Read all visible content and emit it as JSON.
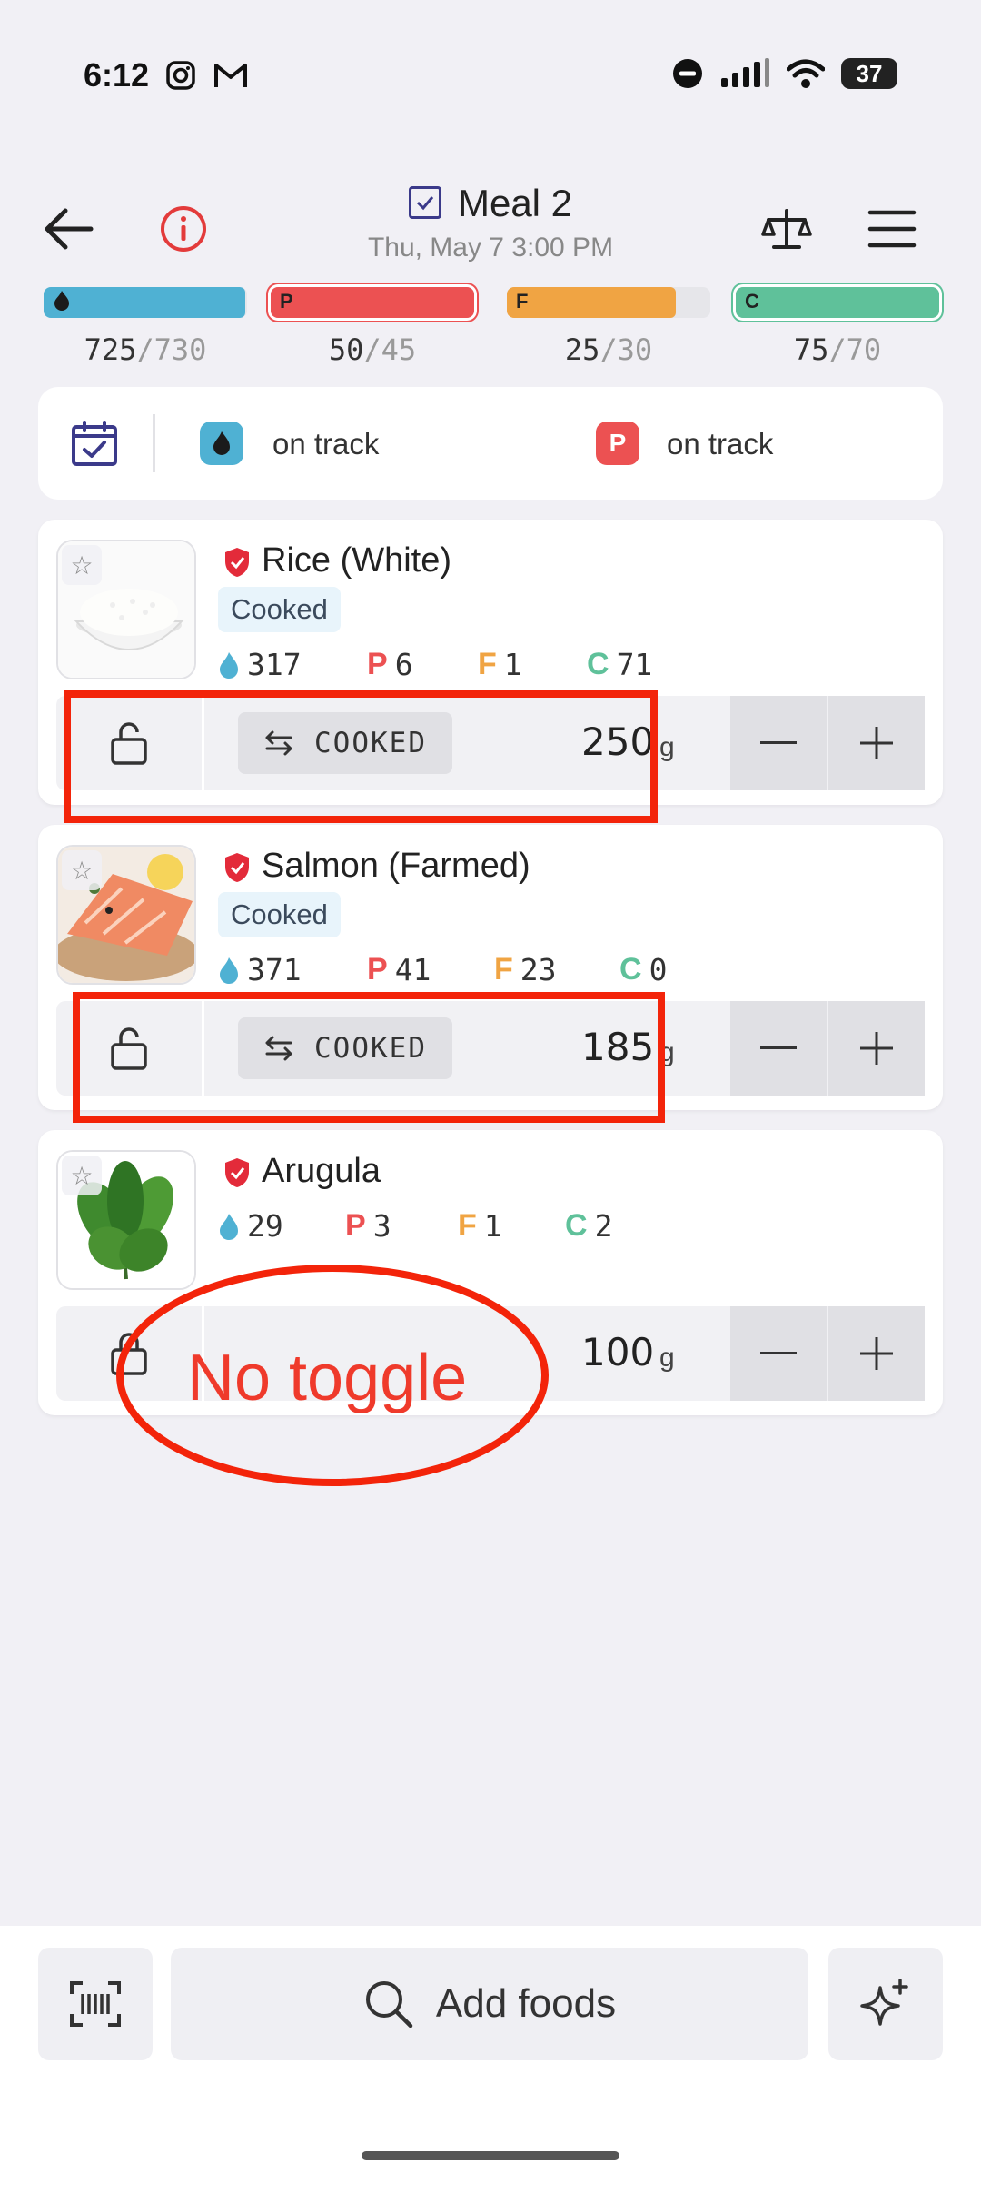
{
  "status_bar": {
    "time": "6:12",
    "battery": "37"
  },
  "header": {
    "title": "Meal 2",
    "subtitle": "Thu, May 7 3:00 PM"
  },
  "macros": [
    {
      "letter": "",
      "current": "725",
      "target": "/730",
      "color": "#4fb1d3",
      "fill": 0.99,
      "outline": false
    },
    {
      "letter": "P",
      "current": "50",
      "target": "/45",
      "color": "#ec5152",
      "fill": 1.0,
      "outline": true
    },
    {
      "letter": "F",
      "current": "25",
      "target": "/30",
      "color": "#f0a443",
      "fill": 0.83,
      "outline": false
    },
    {
      "letter": "C",
      "current": "75",
      "target": "/70",
      "color": "#5fc19a",
      "fill": 1.0,
      "outline": true
    }
  ],
  "tracking": {
    "calories_status": "on track",
    "protein_letter": "P",
    "protein_status": "on track"
  },
  "foods": [
    {
      "name": "Rice (White)",
      "tag": "Cooked",
      "calories": "317",
      "protein_letter": "P",
      "protein": "6",
      "fat_letter": "F",
      "fat": "1",
      "carb_letter": "C",
      "carbs": "71",
      "toggle_label": "COOKED",
      "amount": "250",
      "unit": "g"
    },
    {
      "name": "Salmon (Farmed)",
      "tag": "Cooked",
      "calories": "371",
      "protein_letter": "P",
      "protein": "41",
      "fat_letter": "F",
      "fat": "23",
      "carb_letter": "C",
      "carbs": "0",
      "toggle_label": "COOKED",
      "amount": "185",
      "unit": "g"
    },
    {
      "name": "Arugula",
      "calories": "29",
      "protein_letter": "P",
      "protein": "3",
      "fat_letter": "F",
      "fat": "1",
      "carb_letter": "C",
      "carbs": "2",
      "amount": "100",
      "unit": "g"
    }
  ],
  "annotation": {
    "text": "No toggle"
  },
  "bottom": {
    "add_foods": "Add foods"
  },
  "colors": {
    "calories": "#4fb1d3",
    "protein": "#ec5152",
    "fat": "#f0a443",
    "carbs": "#5fc19a",
    "annotation": "#f3240a",
    "brand": "#3b3a8a"
  }
}
